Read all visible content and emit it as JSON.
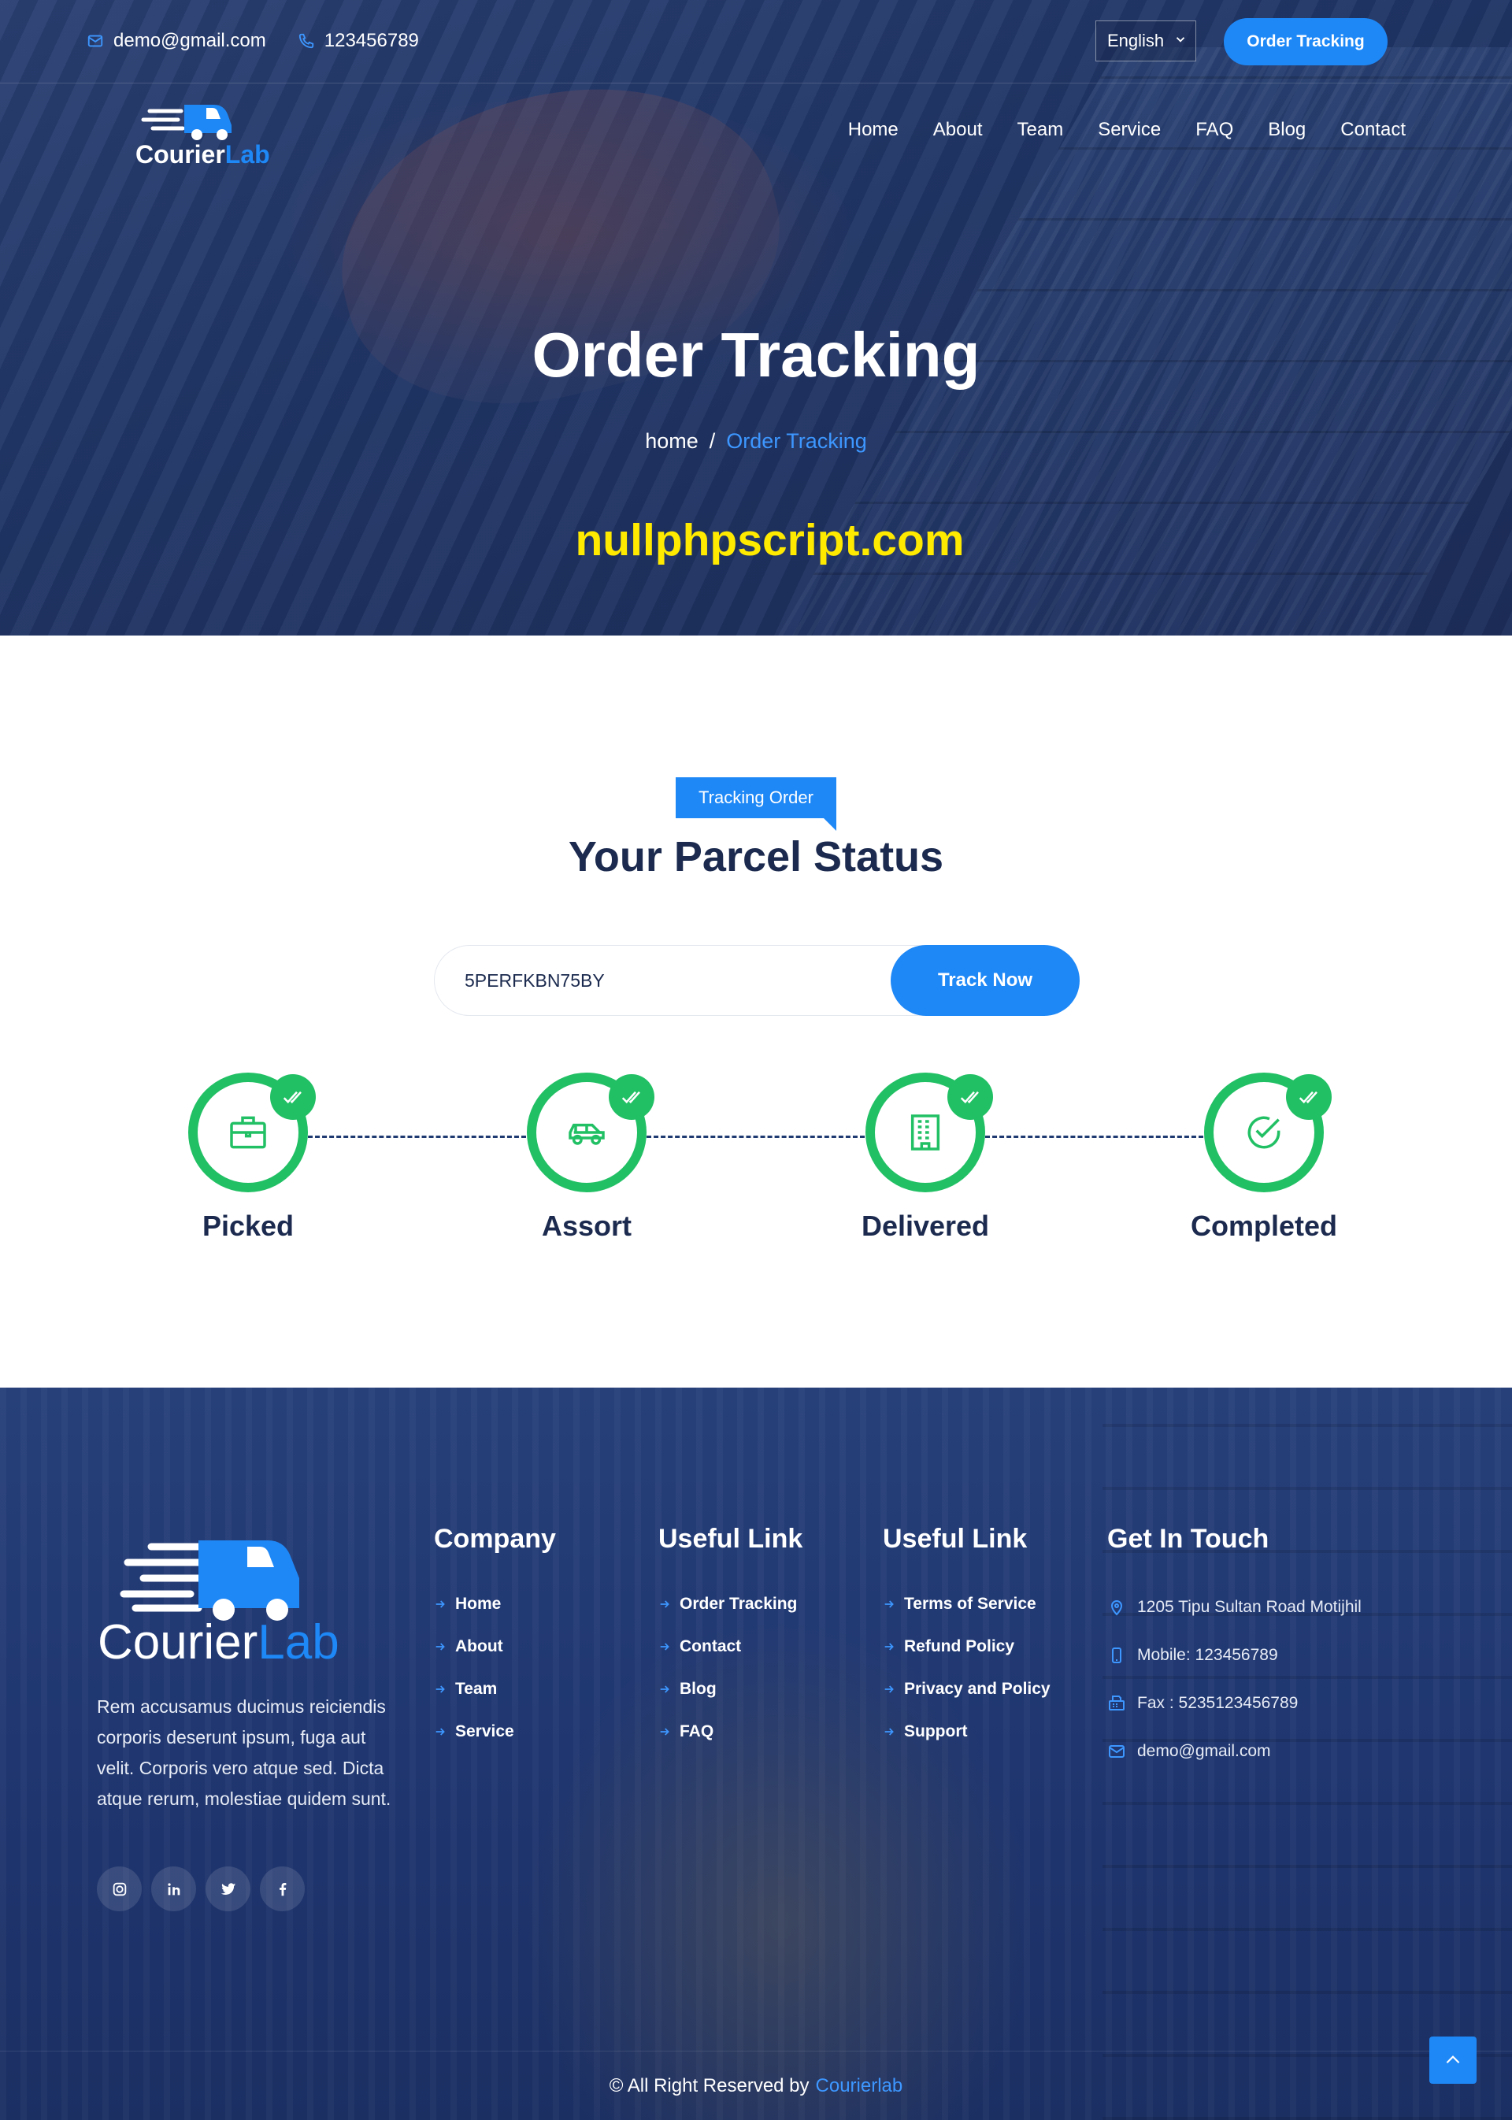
{
  "topbar": {
    "email": "demo@gmail.com",
    "phone": "123456789",
    "language": "English",
    "cta_label": "Order Tracking"
  },
  "logo": {
    "word1": "Courier",
    "word2": "Lab"
  },
  "nav": {
    "items": [
      {
        "label": "Home"
      },
      {
        "label": "About"
      },
      {
        "label": "Team"
      },
      {
        "label": "Service"
      },
      {
        "label": "FAQ"
      },
      {
        "label": "Blog"
      },
      {
        "label": "Contact"
      }
    ]
  },
  "hero": {
    "title": "Order Tracking",
    "breadcrumb_home": "home",
    "breadcrumb_sep": "/",
    "breadcrumb_current": "Order Tracking",
    "watermark": "nullphpscript.com"
  },
  "tracking": {
    "tag": "Tracking Order",
    "title": "Your Parcel Status",
    "input_value": "5PERFKBN75BY",
    "button_label": "Track Now",
    "steps": [
      {
        "label": "Picked",
        "icon": "briefcase-icon"
      },
      {
        "label": "Assort",
        "icon": "car-icon"
      },
      {
        "label": "Delivered",
        "icon": "building-icon"
      },
      {
        "label": "Completed",
        "icon": "check-circle-icon"
      }
    ]
  },
  "footer": {
    "about": "Rem accusamus ducimus reiciendis corporis deserunt ipsum, fuga aut velit. Corporis vero atque sed. Dicta atque rerum, molestiae quidem sunt.",
    "socials": [
      "instagram-icon",
      "linkedin-icon",
      "twitter-icon",
      "facebook-icon"
    ],
    "company": {
      "title": "Company",
      "links": [
        "Home",
        "About",
        "Team",
        "Service"
      ]
    },
    "useful1": {
      "title": "Useful Link",
      "links": [
        "Order Tracking",
        "Contact",
        "Blog",
        "FAQ"
      ]
    },
    "useful2": {
      "title": "Useful Link",
      "links": [
        "Terms of Service",
        "Refund Policy",
        "Privacy and Policy",
        "Support"
      ]
    },
    "contact": {
      "title": "Get In Touch",
      "address": "1205 Tipu Sultan Road Motijhil",
      "mobile": "Mobile: 123456789",
      "fax": "Fax : 5235123456789",
      "email": "demo@gmail.com"
    },
    "copyright": "© All Right Reserved by",
    "copyright_brand": "Courierlab"
  },
  "colors": {
    "accent": "#1e88f7",
    "success": "#22c065",
    "navy": "#1b2a4e",
    "watermark": "#ffea00"
  }
}
